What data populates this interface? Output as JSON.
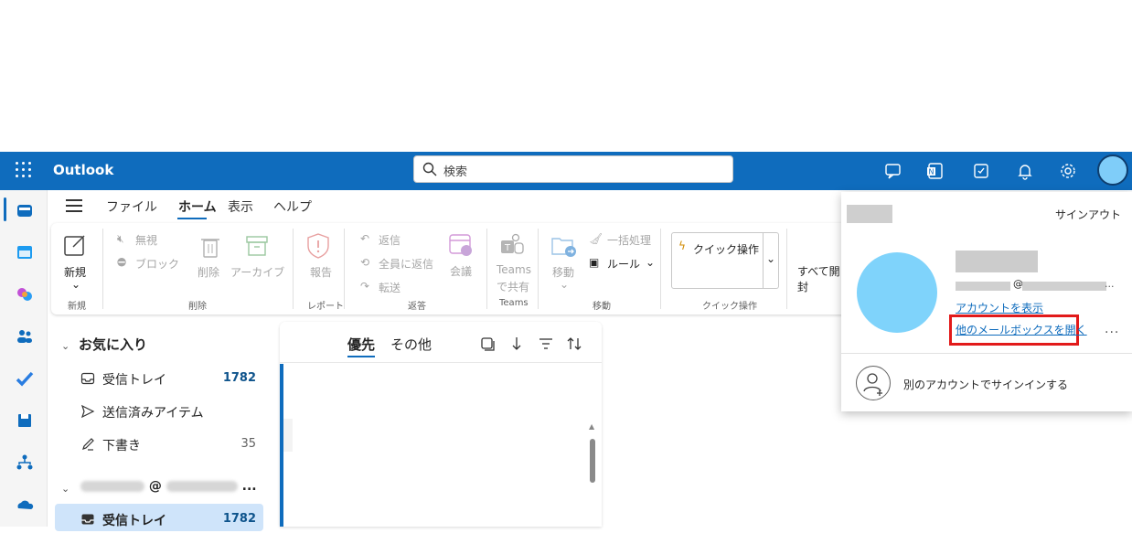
{
  "app": {
    "name": "Outlook"
  },
  "search": {
    "placeholder": "検索"
  },
  "menu": {
    "items": [
      "ファイル",
      "ホーム",
      "表示",
      "ヘルプ"
    ],
    "active_index": 1
  },
  "ribbon": {
    "new_label": "新規",
    "ignore": "無視",
    "block": "ブロック",
    "delete": "削除",
    "archive": "アーカイブ",
    "report": "報告",
    "reply": "返信",
    "reply_all": "全員に返信",
    "forward": "転送",
    "meeting": "会議",
    "teams_share_1": "Teams",
    "teams_share_2": "で共有",
    "move": "移動",
    "sweep": "一括処理",
    "rules": "ルール",
    "quick_action": "クイック操作",
    "open_all": "すべて開封",
    "groups": {
      "new": "新規",
      "delete": "削除",
      "report": "レポート",
      "respond": "返答",
      "teams": "Teams",
      "move": "移動",
      "quick": "クイック操作"
    }
  },
  "folders": {
    "favorites": "お気に入り",
    "items": [
      {
        "label": "受信トレイ",
        "count": "1782"
      },
      {
        "label": "送信済みアイテム",
        "count": ""
      },
      {
        "label": "下書き",
        "count": "35"
      }
    ],
    "account_at": "@",
    "account_ellipsis": "...",
    "account_inbox": {
      "label": "受信トレイ",
      "count": "1782"
    }
  },
  "message_list": {
    "tab_focused": "優先",
    "tab_other": "その他"
  },
  "flyout": {
    "signout": "サインアウト",
    "at": "@",
    "ellipsis": "...",
    "view_account": "アカウントを表示",
    "open_other_mailbox": "他のメールボックスを開く",
    "more": "...",
    "sign_in_other": "別のアカウントでサインインする"
  },
  "colors": {
    "accent": "#0f6cbd",
    "highlight": "#e21a1a",
    "avatar": "#7fd3fb"
  }
}
